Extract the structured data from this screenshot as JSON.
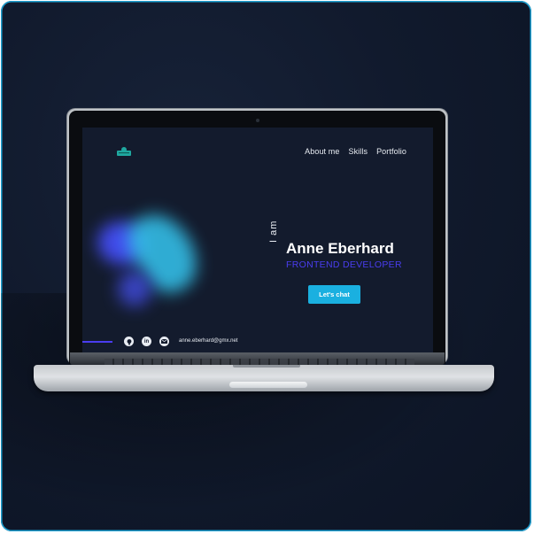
{
  "nav": {
    "items": [
      {
        "label": "About me"
      },
      {
        "label": "Skills"
      },
      {
        "label": "Portfolio"
      }
    ]
  },
  "hero": {
    "prefix": "I am",
    "name": "Anne Eberhard",
    "role": "FRONTEND DEVELOPER",
    "cta_label": "Let's chat"
  },
  "footer": {
    "email": "anne.eberhard@gmx.net",
    "social_icons": [
      "github-icon",
      "linkedin-icon",
      "mail-icon"
    ]
  },
  "colors": {
    "background": "#131b2d",
    "accent_blue": "#1ab0e0",
    "accent_purple": "#4a3df0",
    "logo": "#1fa8a0"
  }
}
